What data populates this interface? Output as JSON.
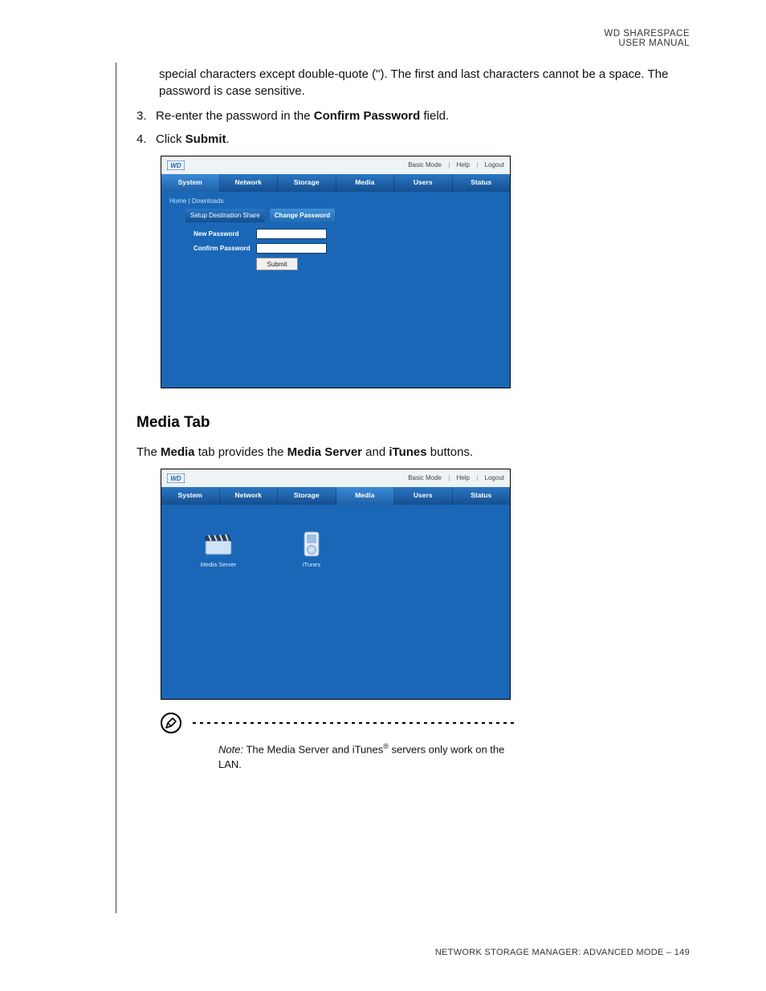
{
  "header": {
    "line1": "WD SHARESPACE",
    "line2": "USER MANUAL"
  },
  "intro_continuation": "special characters except double-quote (\"). The first and last characters cannot be a space. The password is case sensitive.",
  "steps": {
    "s3_num": "3.",
    "s3_a": "Re-enter the password in the ",
    "s3_b": "Confirm Password",
    "s3_c": " field.",
    "s4_num": "4.",
    "s4_a": "Click ",
    "s4_b": "Submit",
    "s4_c": "."
  },
  "shot1": {
    "logo": "WD",
    "top_links": {
      "mode": "Basic Mode",
      "help": "Help",
      "logout": "Logout"
    },
    "tabs": [
      "System",
      "Network",
      "Storage",
      "Media",
      "Users",
      "Status"
    ],
    "breadcrumb": "Home | Downloads",
    "subtabs": {
      "a": "Setup Destination Share",
      "b": "Change Password"
    },
    "form": {
      "new_pw": "New Password",
      "confirm_pw": "Confirm Password",
      "submit": "Submit"
    }
  },
  "section_heading": "Media Tab",
  "media_intro": {
    "a": "The ",
    "b": "Media",
    "c": " tab provides the ",
    "d": "Media Server",
    "e": " and ",
    "f": "iTunes",
    "g": " buttons."
  },
  "shot2": {
    "logo": "WD",
    "top_links": {
      "mode": "Basic Mode",
      "help": "Help",
      "logout": "Logout"
    },
    "tabs": [
      "System",
      "Network",
      "Storage",
      "Media",
      "Users",
      "Status"
    ],
    "icons": {
      "media_server": "Media Server",
      "itunes": "iTunes"
    }
  },
  "note": {
    "label": "Note:",
    "a": " The Media Server and iTunes",
    "reg": "®",
    "b": " servers only work on the LAN."
  },
  "footer": "NETWORK STORAGE MANAGER: ADVANCED MODE – 149"
}
